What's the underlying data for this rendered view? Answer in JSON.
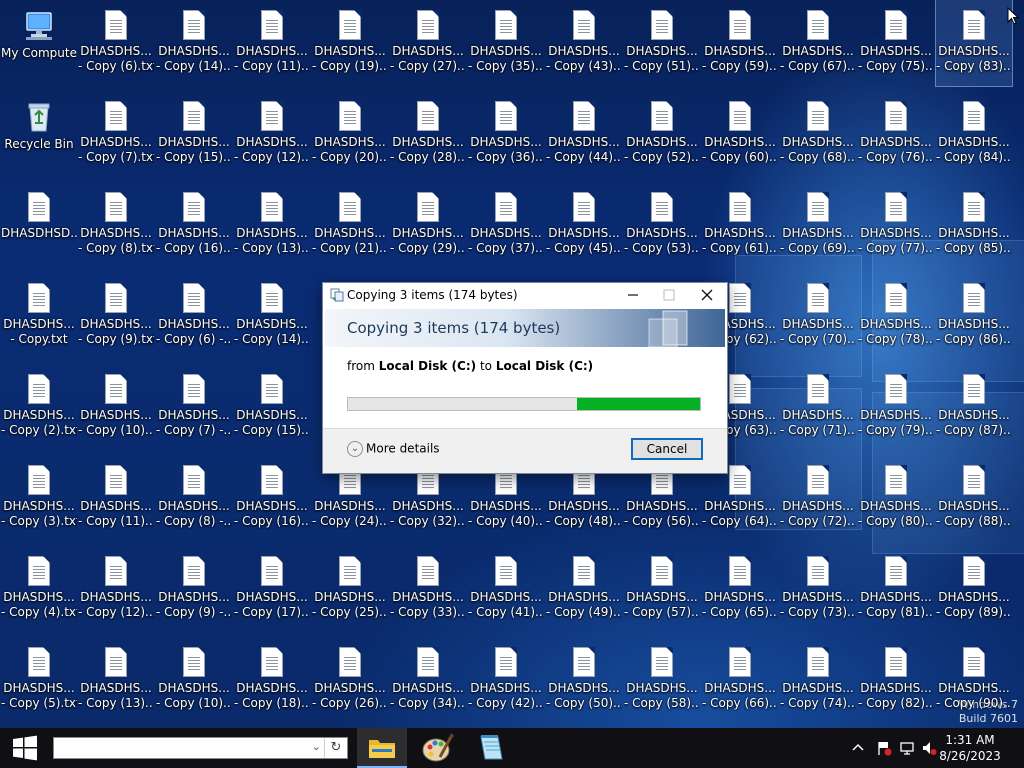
{
  "desktop": {
    "system_icons": {
      "my_computer": "My Computer",
      "recycle_bin": "Recycle Bin"
    },
    "column0": [
      "DHASDHSD...",
      "DHASDHS...\n- Copy.txt",
      "DHASDHS...\n- Copy (2).txt",
      "DHASDHS...\n- Copy (3).txt",
      "DHASDHS...\n- Copy (4).txt",
      "DHASDHS...\n- Copy (5).txt"
    ],
    "grid": [
      [
        "DHASDHS...\n- Copy (6).txt",
        "DHASDHS...\n- Copy (14)...",
        "DHASDHS...\n- Copy (11)...",
        "DHASDHS...\n- Copy (19)...",
        "DHASDHS...\n- Copy (27)...",
        "DHASDHS...\n- Copy (35)...",
        "DHASDHS...\n- Copy (43)...",
        "DHASDHS...\n- Copy (51)...",
        "DHASDHS...\n- Copy (59)...",
        "DHASDHS...\n- Copy (67)...",
        "DHASDHS...\n- Copy (75)...",
        "DHASDHS...\n- Copy (83)..."
      ],
      [
        "DHASDHS...\n- Copy (7).txt",
        "DHASDHS...\n- Copy (15)...",
        "DHASDHS...\n- Copy (12)...",
        "DHASDHS...\n- Copy (20)...",
        "DHASDHS...\n- Copy (28)...",
        "DHASDHS...\n- Copy (36)...",
        "DHASDHS...\n- Copy (44)...",
        "DHASDHS...\n- Copy (52)...",
        "DHASDHS...\n- Copy (60)...",
        "DHASDHS...\n- Copy (68)...",
        "DHASDHS...\n- Copy (76)...",
        "DHASDHS...\n- Copy (84)..."
      ],
      [
        "DHASDHS...\n- Copy (8).txt",
        "DHASDHS...\n- Copy (16)...",
        "DHASDHS...\n- Copy (13)...",
        "DHASDHS...\n- Copy (21)...",
        "DHASDHS...\n- Copy (29)...",
        "DHASDHS...\n- Copy (37)...",
        "DHASDHS...\n- Copy (45)...",
        "DHASDHS...\n- Copy (53)...",
        "DHASDHS...\n- Copy (61)...",
        "DHASDHS...\n- Copy (69)...",
        "DHASDHS...\n- Copy (77)...",
        "DHASDHS...\n- Copy (85)..."
      ],
      [
        "DHASDHS...\n- Copy (9).txt",
        "DHASDHS...\n- Copy (6) -...",
        "DHASDHS...\n- Copy (14)...",
        "",
        "",
        "",
        "",
        "",
        "DHASDHS...\n- Copy (62)...",
        "DHASDHS...\n- Copy (70)...",
        "DHASDHS...\n- Copy (78)...",
        "DHASDHS...\n- Copy (86)..."
      ],
      [
        "DHASDHS...\n- Copy (10)...",
        "DHASDHS...\n- Copy (7) -...",
        "DHASDHS...\n- Copy (15)...",
        "",
        "",
        "",
        "",
        "",
        "DHASDHS...\n- Copy (63)...",
        "DHASDHS...\n- Copy (71)...",
        "DHASDHS...\n- Copy (79)...",
        "DHASDHS...\n- Copy (87)..."
      ],
      [
        "DHASDHS...\n- Copy (11)...",
        "DHASDHS...\n- Copy (8) -...",
        "DHASDHS...\n- Copy (16)...",
        "DHASDHS...\n- Copy (24)...",
        "DHASDHS...\n- Copy (32)...",
        "DHASDHS...\n- Copy (40)...",
        "DHASDHS...\n- Copy (48)...",
        "DHASDHS...\n- Copy (56)...",
        "DHASDHS...\n- Copy (64)...",
        "DHASDHS...\n- Copy (72)...",
        "DHASDHS...\n- Copy (80)...",
        "DHASDHS...\n- Copy (88)..."
      ],
      [
        "DHASDHS...\n- Copy (12)...",
        "DHASDHS...\n- Copy (9) -...",
        "DHASDHS...\n- Copy (17)...",
        "DHASDHS...\n- Copy (25)...",
        "DHASDHS...\n- Copy (33)...",
        "DHASDHS...\n- Copy (41)...",
        "DHASDHS...\n- Copy (49)...",
        "DHASDHS...\n- Copy (57)...",
        "DHASDHS...\n- Copy (65)...",
        "DHASDHS...\n- Copy (73)...",
        "DHASDHS...\n- Copy (81)...",
        "DHASDHS...\n- Copy (89)..."
      ],
      [
        "DHASDHS...\n- Copy (13)...",
        "DHASDHS...\n- Copy (10)...",
        "DHASDHS...\n- Copy (18)...",
        "DHASDHS...\n- Copy (26)...",
        "DHASDHS...\n- Copy (34)...",
        "DHASDHS...\n- Copy (42)...",
        "DHASDHS...\n- Copy (50)...",
        "DHASDHS...\n- Copy (58)...",
        "DHASDHS...\n- Copy (66)...",
        "DHASDHS...\n- Copy (74)...",
        "DHASDHS...\n- Copy (82)...",
        "DHASDHS...\n- Copy (90)..."
      ]
    ],
    "selected_icon": "DHASDHS...\n- Copy (83)...",
    "watermark": {
      "line1": "Windows 7",
      "line2": "Build 7601"
    }
  },
  "dialog": {
    "title": "Copying 3 items (174 bytes)",
    "heading": "Copying 3 items (174 bytes)",
    "from_prefix": "from",
    "from_location": "Local Disk (C:)",
    "to_word": "to",
    "to_location": "Local Disk (C:)",
    "progress_fraction": 0.65,
    "more_details_label": "More details",
    "cancel_label": "Cancel",
    "minimize_icon": "minimize-icon",
    "maximize_icon": "maximize-icon",
    "close_icon": "close-icon"
  },
  "taskbar": {
    "search_value": "",
    "apps": [
      "file-explorer-icon",
      "paint-icon",
      "notepad-icon"
    ],
    "active_app": "file-explorer-icon",
    "tray_icons": [
      "chevron-up-icon",
      "flag-icon",
      "network-icon",
      "volume-icon"
    ],
    "clock_time": "1:31 AM",
    "clock_date": "8/26/2023"
  },
  "colors": {
    "progress_green": "#06b025",
    "cancel_focus_border": "#0f6bc0",
    "desktop_blue": "#0a2b6f"
  }
}
